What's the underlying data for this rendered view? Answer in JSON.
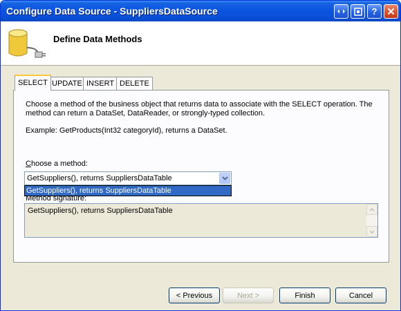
{
  "window": {
    "title": "Configure Data Source - SuppliersDataSource",
    "controls": [
      "help-icon",
      "restore-icon",
      "question-icon",
      "close-icon"
    ]
  },
  "header": {
    "title": "Define Data Methods",
    "icon": "database-plug-icon"
  },
  "tabs": [
    {
      "label": "SELECT",
      "active": true
    },
    {
      "label": "UPDATE",
      "active": false
    },
    {
      "label": "INSERT",
      "active": false
    },
    {
      "label": "DELETE",
      "active": false
    }
  ],
  "panel": {
    "description": "Choose a method of the business object that returns data to associate with the SELECT operation. The method can return a DataSet, DataReader, or strongly-typed collection.",
    "example": "Example: GetProducts(Int32 categoryId), returns a DataSet.",
    "choose_label": "Choose a method:",
    "method_select": {
      "value": "GetSuppliers(), returns SuppliersDataTable",
      "options": [
        "GetSuppliers(), returns SuppliersDataTable"
      ]
    },
    "signature_label": "Method signature:",
    "signature_value": "GetSuppliers(), returns SuppliersDataTable"
  },
  "buttons": {
    "previous": "< Previous",
    "next": "Next >",
    "finish": "Finish",
    "cancel": "Cancel"
  },
  "colors": {
    "titlebar": "#0b55e0",
    "selection": "#316ac5",
    "tab_highlight": "#ffc83c",
    "dialog_bg": "#ece9d8"
  }
}
